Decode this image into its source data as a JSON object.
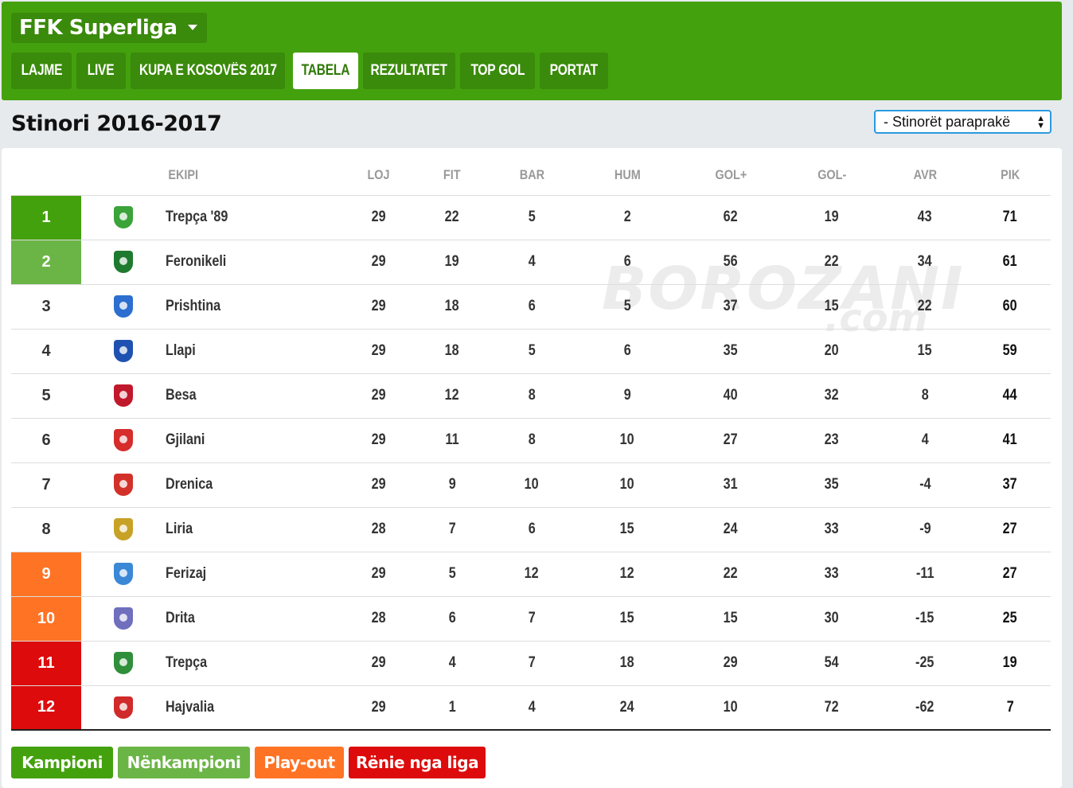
{
  "header": {
    "league_name": "FFK Superliga",
    "nav": [
      {
        "label": "LAJME",
        "active": false
      },
      {
        "label": "LIVE",
        "active": false
      },
      {
        "label": "KUPA E KOSOVËS 2017",
        "active": false
      },
      {
        "label": "TABELA",
        "active": true
      },
      {
        "label": "REZULTATET",
        "active": false
      },
      {
        "label": "TOP GOL",
        "active": false
      },
      {
        "label": "PORTAT",
        "active": false
      }
    ]
  },
  "season": {
    "title": "Stinori 2016-2017",
    "select_value": "- Stinorët paraprakë"
  },
  "table": {
    "headers": {
      "team": "EKIPI",
      "played": "LOJ",
      "won": "FIT",
      "drawn": "BAR",
      "lost": "HUM",
      "goals_for": "GOL+",
      "goals_against": "GOL-",
      "goal_diff": "AVR",
      "points": "PIK"
    },
    "rows": [
      {
        "pos": "1",
        "team": "Trepça '89",
        "played": "29",
        "won": "22",
        "drawn": "5",
        "lost": "2",
        "gf": "62",
        "ga": "19",
        "gd": "43",
        "pts": "71",
        "zone": "champion",
        "crest_color": "#3aa33a"
      },
      {
        "pos": "2",
        "team": "Feronikeli",
        "played": "29",
        "won": "19",
        "drawn": "4",
        "lost": "6",
        "gf": "56",
        "ga": "22",
        "gd": "34",
        "pts": "61",
        "zone": "runner-up",
        "crest_color": "#1e7a2e"
      },
      {
        "pos": "3",
        "team": "Prishtina",
        "played": "29",
        "won": "18",
        "drawn": "6",
        "lost": "5",
        "gf": "37",
        "ga": "15",
        "gd": "22",
        "pts": "60",
        "zone": "",
        "crest_color": "#2d6fd0"
      },
      {
        "pos": "4",
        "team": "Llapi",
        "played": "29",
        "won": "18",
        "drawn": "5",
        "lost": "6",
        "gf": "35",
        "ga": "20",
        "gd": "15",
        "pts": "59",
        "zone": "",
        "crest_color": "#1f52b0"
      },
      {
        "pos": "5",
        "team": "Besa",
        "played": "29",
        "won": "12",
        "drawn": "8",
        "lost": "9",
        "gf": "40",
        "ga": "32",
        "gd": "8",
        "pts": "44",
        "zone": "",
        "crest_color": "#c0192b"
      },
      {
        "pos": "6",
        "team": "Gjilani",
        "played": "29",
        "won": "11",
        "drawn": "8",
        "lost": "10",
        "gf": "27",
        "ga": "23",
        "gd": "4",
        "pts": "41",
        "zone": "",
        "crest_color": "#d62c2c"
      },
      {
        "pos": "7",
        "team": "Drenica",
        "played": "29",
        "won": "9",
        "drawn": "10",
        "lost": "10",
        "gf": "31",
        "ga": "35",
        "gd": "-4",
        "pts": "37",
        "zone": "",
        "crest_color": "#d2312a"
      },
      {
        "pos": "8",
        "team": "Liria",
        "played": "28",
        "won": "7",
        "drawn": "6",
        "lost": "15",
        "gf": "24",
        "ga": "33",
        "gd": "-9",
        "pts": "27",
        "zone": "",
        "crest_color": "#c8a227"
      },
      {
        "pos": "9",
        "team": "Ferizaj",
        "played": "29",
        "won": "5",
        "drawn": "12",
        "lost": "12",
        "gf": "22",
        "ga": "33",
        "gd": "-11",
        "pts": "27",
        "zone": "play-out",
        "crest_color": "#3b88d6"
      },
      {
        "pos": "10",
        "team": "Drita",
        "played": "28",
        "won": "6",
        "drawn": "7",
        "lost": "15",
        "gf": "15",
        "ga": "30",
        "gd": "-15",
        "pts": "25",
        "zone": "play-out",
        "crest_color": "#6f6fbe"
      },
      {
        "pos": "11",
        "team": "Trepça",
        "played": "29",
        "won": "4",
        "drawn": "7",
        "lost": "18",
        "gf": "29",
        "ga": "54",
        "gd": "-25",
        "pts": "19",
        "zone": "relegation",
        "crest_color": "#2f8f3a"
      },
      {
        "pos": "12",
        "team": "Hajvalia",
        "played": "29",
        "won": "1",
        "drawn": "4",
        "lost": "24",
        "gf": "10",
        "ga": "72",
        "gd": "-62",
        "pts": "7",
        "zone": "relegation",
        "crest_color": "#d02a2a"
      }
    ]
  },
  "legend": [
    {
      "label": "Kampioni",
      "color": "#44a10e"
    },
    {
      "label": "Nënkampioni",
      "color": "#6bb546"
    },
    {
      "label": "Play-out",
      "color": "#ff7324"
    },
    {
      "label": "Rënie nga liga",
      "color": "#dd0b0b"
    }
  ],
  "watermark": {
    "big": "BOROZANI",
    "small": ".com"
  },
  "colors": {
    "brand_green": "#44a10e",
    "dark_green": "#3a8a0b",
    "select_border": "#2a9be0"
  }
}
